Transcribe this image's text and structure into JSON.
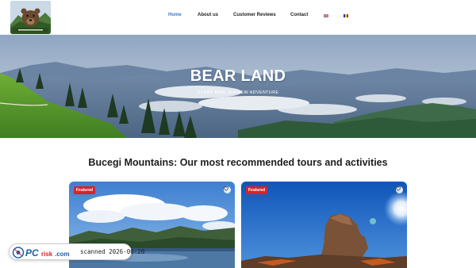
{
  "header": {
    "logo_alt": "Bear Land logo",
    "nav": [
      {
        "label": "Home",
        "active": true
      },
      {
        "label": "About us",
        "active": false
      },
      {
        "label": "Customer Reviews",
        "active": false
      },
      {
        "label": "Contact",
        "active": false
      }
    ],
    "languages": [
      "en-flag-icon",
      "ro-flag-icon"
    ]
  },
  "hero": {
    "title": "BEAR LAND",
    "subtitle": "EVERY RIDE IS A NEW ADVENTURE"
  },
  "section": {
    "title": "Bucegi Mountains: Our most recommended tours and activities"
  },
  "cards": [
    {
      "badge": "Featured",
      "icon": "heart-icon"
    },
    {
      "badge": "Featured",
      "icon": "heart-icon"
    }
  ],
  "watermark": {
    "brand": "PCrisk.com",
    "scan_text": "scanned 2026-06-20"
  },
  "colors": {
    "nav_active": "#3b7ac8",
    "badge": "#d8232a",
    "watermark_blue": "#1c5fa8",
    "watermark_red": "#d8232a"
  }
}
